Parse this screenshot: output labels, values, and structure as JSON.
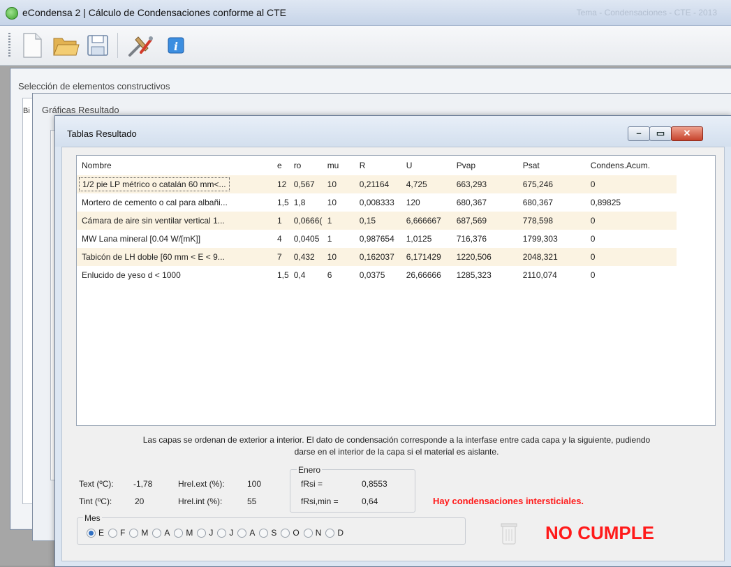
{
  "app": {
    "title": "eCondensa 2 | Cálculo de Condensaciones conforme al CTE",
    "title_faded": "Tema - Condensaciones - CTE - 2013"
  },
  "toolbar": {
    "buttons": [
      {
        "name": "new-document-icon"
      },
      {
        "name": "open-folder-icon"
      },
      {
        "name": "save-icon"
      },
      {
        "name": "tools-icon"
      },
      {
        "name": "info-icon"
      }
    ]
  },
  "background_windows": {
    "seleccion_title": "Selección de elementos constructivos",
    "seleccion_tab_fragment": "Bi",
    "graficas_title": "Gráficas Resultado"
  },
  "window": {
    "title": "Tablas Resultado"
  },
  "table": {
    "columns": [
      "Nombre",
      "e",
      "ro",
      "mu",
      "R",
      "U",
      "Pvap",
      "Psat",
      "Condens.Acum."
    ],
    "rows": [
      [
        "1/2 pie LP métrico o catalán 60 mm<...",
        "12",
        "0,567",
        "10",
        "0,21164",
        "4,725",
        "663,293",
        "675,246",
        "0"
      ],
      [
        "Mortero de cemento o cal para albañi...",
        "1,5",
        "1,8",
        "10",
        "0,008333",
        "120",
        "680,367",
        "680,367",
        "0,89825"
      ],
      [
        "Cámara de aire sin ventilar vertical 1...",
        "1",
        "0,0666(",
        "1",
        "0,15",
        "6,666667",
        "687,569",
        "778,598",
        "0"
      ],
      [
        "MW Lana mineral [0.04 W/[mK]]",
        "4",
        "0,0405",
        "1",
        "0,987654",
        "1,0125",
        "716,376",
        "1799,303",
        "0"
      ],
      [
        "Tabicón de LH doble [60 mm < E < 9...",
        "7",
        "0,432",
        "10",
        "0,162037",
        "6,171429",
        "1220,506",
        "2048,321",
        "0"
      ],
      [
        "Enlucido de yeso d < 1000",
        "1,5",
        "0,4",
        "6",
        "0,0375",
        "26,66666",
        "1285,323",
        "2110,074",
        "0"
      ]
    ]
  },
  "note": {
    "line1": "Las capas se ordenan de exterior a interior. El dato de condensación corresponde a la interfase entre cada capa y la siguiente,  pudiendo",
    "line2": "darse en el interior de la capa si el material es aislante."
  },
  "conditions": {
    "text_label": "Text (ºC):",
    "text_value": "-1,78",
    "tint_label": "Tint (ºC):",
    "tint_value": "20",
    "hrel_ext_label": "Hrel.ext (%):",
    "hrel_ext_value": "100",
    "hrel_int_label": "Hrel.int (%):",
    "hrel_int_value": "55"
  },
  "enero": {
    "group_label": "Enero",
    "frsi_label": "fRsi =",
    "frsi_value": "0,8553",
    "frsimin_label": "fRsi,min =",
    "frsimin_value": "0,64"
  },
  "status": {
    "warning": "Hay condensaciones intersticiales.",
    "result": "NO CUMPLE"
  },
  "mes": {
    "group_label": "Mes",
    "options": [
      "E",
      "F",
      "M",
      "A",
      "M",
      "J",
      "J",
      "A",
      "S",
      "O",
      "N",
      "D"
    ],
    "selected_index": 0
  },
  "colors": {
    "alert": "#ff1a1a",
    "row_alt": "#fbf3e2",
    "title_gradient": "#d3dfee"
  }
}
